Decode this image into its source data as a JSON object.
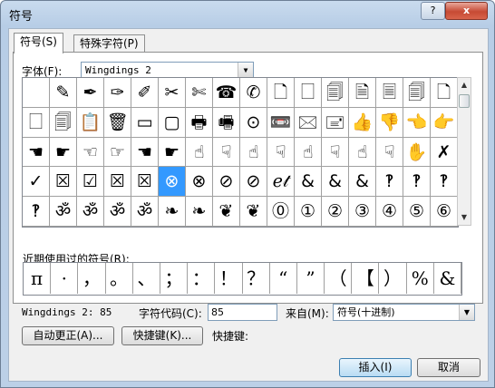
{
  "window": {
    "title": "符号",
    "help_label": "?",
    "close_label": "x"
  },
  "tabs": [
    {
      "label": "符号(S)"
    },
    {
      "label": "特殊字符(P)"
    }
  ],
  "font": {
    "label": "字体(F):",
    "value": "Wingdings 2"
  },
  "symbol_grid": {
    "rows": [
      [
        "",
        "✎",
        "✒",
        "✑",
        "✐",
        "✂",
        "✄",
        "☎",
        "✆",
        "🗋",
        "🗌",
        "🗐",
        "🗎",
        "🗏",
        "🗐",
        "🗋"
      ],
      [
        "🗌",
        "🗐",
        "📋",
        "🗑",
        "▭",
        "▢",
        "🖶",
        "🖷",
        "⊙",
        "📼",
        "🖂",
        "🖃",
        "👍",
        "👎",
        "👈",
        "👉"
      ],
      [
        "☚",
        "☛",
        "☜",
        "☞",
        "☚",
        "☛",
        "☝",
        "☟",
        "☝",
        "☟",
        "☝",
        "☟",
        "☝",
        "☟",
        "✋",
        "✗"
      ],
      [
        "✓",
        "☒",
        "☑",
        "☒",
        "☒",
        "⊗",
        "⊗",
        "⊘",
        "⊘",
        "ℯ𝓉",
        "&",
        "&",
        "&",
        "‽",
        "‽",
        "‽"
      ],
      [
        "‽",
        "ॐ",
        "ॐ",
        "ॐ",
        "ॐ",
        "❧",
        "❧",
        "❦",
        "❦",
        "⓪",
        "①",
        "②",
        "③",
        "④",
        "⑤",
        "⑥"
      ]
    ],
    "selected_row": 3,
    "selected_col": 5
  },
  "recent": {
    "label": "近期使用过的符号(R):",
    "symbols": [
      "π",
      "·",
      "，",
      "。",
      "、",
      "；",
      "：",
      "！",
      "？",
      "“",
      "”",
      "（",
      "【",
      "）",
      "%",
      "&"
    ]
  },
  "status": {
    "code_text": "Wingdings 2: 85",
    "char_code_label": "字符代码(C):",
    "char_code_value": "85",
    "from_label": "来自(M):",
    "from_value": "符号(十进制)"
  },
  "buttons": {
    "autocorrect": "自动更正(A)...",
    "shortcut_key": "快捷键(K)...",
    "shortcut_label": "快捷键:",
    "insert": "插入(I)",
    "cancel": "取消"
  },
  "colors": {
    "selection": "#3399ff",
    "title_bar": "#c9dbee"
  }
}
